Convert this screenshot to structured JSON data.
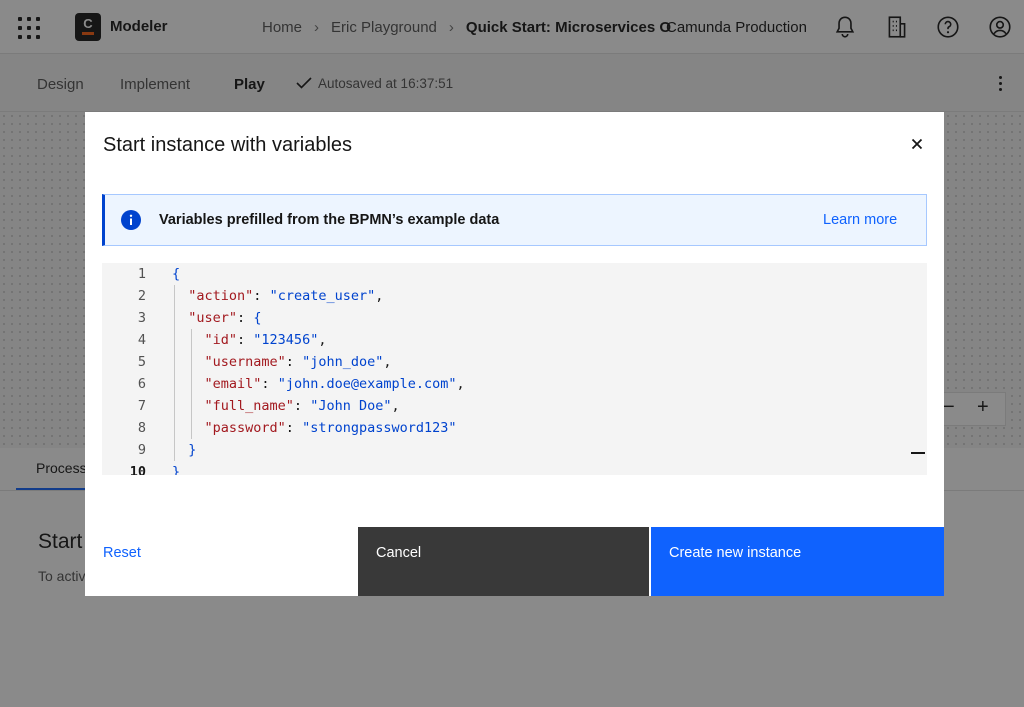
{
  "header": {
    "app_name": "Modeler",
    "logo_letter": "C",
    "breadcrumbs": [
      "Home",
      "Eric Playground",
      "Quick Start: Microservices O"
    ],
    "org_name": "Camunda Production",
    "icons": [
      "app-switcher-icon",
      "notification-bell-icon",
      "organization-building-icon",
      "help-icon",
      "user-avatar-icon"
    ]
  },
  "subbar": {
    "tabs": [
      "Design",
      "Implement",
      "Play"
    ],
    "active_tab": "Play",
    "autosave": "Autosaved at 16:37:51"
  },
  "lower_panel": {
    "tab_label": "Process",
    "title": "Start",
    "text": "To activ"
  },
  "zoom": {
    "minus": "−",
    "plus": "+"
  },
  "modal": {
    "title": "Start instance with variables",
    "close_icon": "close-icon",
    "notification": {
      "icon": "info-icon",
      "text": "Variables prefilled from the BPMN’s example data",
      "link": "Learn more"
    },
    "editor": {
      "current_line": 10,
      "lines": [
        {
          "n": "1",
          "indent": "",
          "key": "",
          "sep": "",
          "value": "",
          "tail": "{"
        },
        {
          "n": "2",
          "indent": "  ",
          "key": "\"action\"",
          "sep": ": ",
          "value": "\"create_user\"",
          "tail": ","
        },
        {
          "n": "3",
          "indent": "  ",
          "key": "\"user\"",
          "sep": ": ",
          "value": "",
          "tail": "{"
        },
        {
          "n": "4",
          "indent": "    ",
          "key": "\"id\"",
          "sep": ": ",
          "value": "\"123456\"",
          "tail": ","
        },
        {
          "n": "5",
          "indent": "    ",
          "key": "\"username\"",
          "sep": ": ",
          "value": "\"john_doe\"",
          "tail": ","
        },
        {
          "n": "6",
          "indent": "    ",
          "key": "\"email\"",
          "sep": ": ",
          "value": "\"john.doe@example.com\"",
          "tail": ","
        },
        {
          "n": "7",
          "indent": "    ",
          "key": "\"full_name\"",
          "sep": ": ",
          "value": "\"John Doe\"",
          "tail": ","
        },
        {
          "n": "8",
          "indent": "    ",
          "key": "\"password\"",
          "sep": ": ",
          "value": "\"strongpassword123\"",
          "tail": ""
        },
        {
          "n": "9",
          "indent": "  ",
          "key": "",
          "sep": "",
          "value": "",
          "tail": "}"
        },
        {
          "n": "10",
          "indent": "",
          "key": "",
          "sep": "",
          "value": "",
          "tail": "}"
        }
      ]
    },
    "buttons": {
      "reset": "Reset",
      "cancel": "Cancel",
      "create": "Create new instance"
    }
  },
  "colors": {
    "primary": "#0f62fe",
    "json_key": "#a2191f",
    "json_string": "#0043ce",
    "cancel_bg": "#393939",
    "notification_bg": "#edf5ff"
  }
}
